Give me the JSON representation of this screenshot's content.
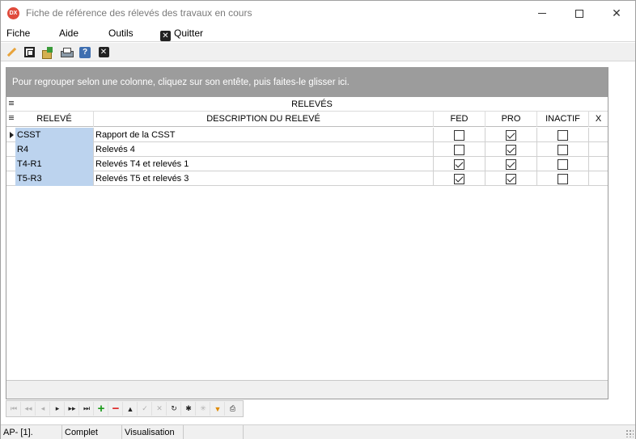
{
  "window": {
    "title": "Fiche de référence des rélevés des travaux en cours",
    "app_icon_text": "DX"
  },
  "menu": {
    "items": [
      "Fiche",
      "Aide",
      "Outils"
    ],
    "quit_label": "Quitter"
  },
  "toolbar": {
    "buttons": [
      "edit-icon",
      "frame-icon",
      "export-icon",
      "print-icon",
      "help-icon",
      "close-icon"
    ]
  },
  "grid": {
    "group_panel_text": "Pour regrouper selon une colonne, cliquez sur son entête, puis faites-le glisser ici.",
    "band_label": "RELEVÉS",
    "columns": [
      "RELEVÉ",
      "DESCRIPTION DU RELEVÉ",
      "FED",
      "PRO",
      "INACTIF",
      "X"
    ],
    "rows": [
      {
        "code": "CSST",
        "description": "Rapport de la CSST",
        "fed": false,
        "pro": true,
        "inactif": false,
        "active": true
      },
      {
        "code": "R4",
        "description": "Relevés 4",
        "fed": false,
        "pro": true,
        "inactif": false,
        "active": false
      },
      {
        "code": "T4-R1",
        "description": "Relevés T4 et relevés 1",
        "fed": true,
        "pro": true,
        "inactif": false,
        "active": false
      },
      {
        "code": "T5-R3",
        "description": "Relevés T5 et relevés 3",
        "fed": true,
        "pro": true,
        "inactif": false,
        "active": false
      }
    ]
  },
  "navigator": {
    "buttons": [
      "first",
      "prev-page",
      "prev",
      "next",
      "next-page",
      "last",
      "insert",
      "delete",
      "edit",
      "post",
      "cancel",
      "refresh",
      "bookmark",
      "goto-bookmark",
      "filter",
      "print"
    ]
  },
  "statusbar": {
    "cells": [
      "AP- [1].",
      "Complet",
      "Visualisation",
      ""
    ]
  },
  "colors": {
    "key_cell": "#bcd3ee",
    "group_panel": "#9c9c9c"
  }
}
